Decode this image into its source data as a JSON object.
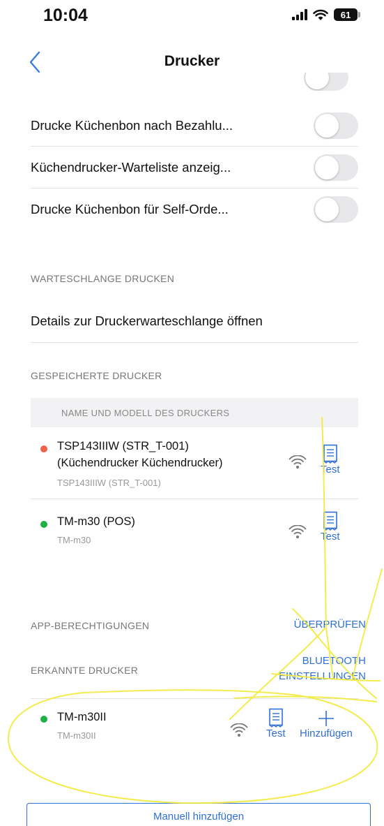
{
  "status_bar": {
    "time": "10:04",
    "battery": "61"
  },
  "nav": {
    "title": "Drucker"
  },
  "toggles": [
    {
      "label": "Drucke Küchenbon nach Bezahlu...",
      "on": false
    },
    {
      "label": "Küchendrucker-Warteliste anzeig...",
      "on": false
    },
    {
      "label": "Drucke Küchenbon für Self-Orde...",
      "on": false
    }
  ],
  "print_queue": {
    "header": "WARTESCHLANGE DRUCKEN",
    "details_label": "Details zur Druckerwarteschlange öffnen"
  },
  "saved_printers": {
    "header": "GESPEICHERTE DRUCKER",
    "column_header": "NAME UND MODELL DES DRUCKERS",
    "items": [
      {
        "name_line1": "TSP143IIIW (STR_T-001)",
        "name_line2": "(Küchendrucker Küchendrucker)",
        "model": "TSP143IIIW (STR_T-001)",
        "status_color": "#f0604d",
        "test_label": "Test"
      },
      {
        "name_line1": "TM-m30 (POS)",
        "name_line2": "",
        "model": "TM-m30",
        "status_color": "#1fb043",
        "test_label": "Test"
      }
    ]
  },
  "app_permissions": {
    "header": "APP-BERECHTIGUNGEN",
    "check_label": "ÜBERPRÜFEN"
  },
  "detected_printers": {
    "header": "ERKANNTE DRUCKER",
    "bluetooth_line1": "BLUETOOTH",
    "bluetooth_line2": "EINSTELLUNGEN",
    "items": [
      {
        "name": "TM-m30II",
        "model": "TM-m30II",
        "status_color": "#1fb043",
        "test_label": "Test",
        "add_label": "Hinzufügen"
      }
    ]
  },
  "manual_add_label": "Manuell hinzufügen",
  "colors": {
    "accent": "#2f6fd6",
    "annotation": "#f2ea3a"
  }
}
